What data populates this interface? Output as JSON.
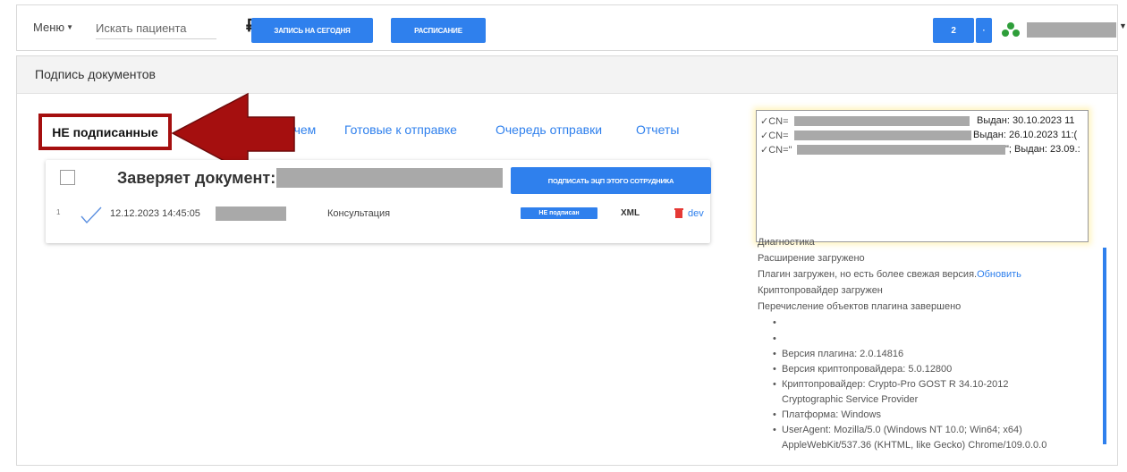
{
  "header": {
    "menu_label": "Меню",
    "search_placeholder": "Искать пациента",
    "currency_symbol": "₽",
    "btn_today": "ЗАПИСЬ НА СЕГОДНЯ",
    "btn_schedule": "РАСПИСАНИЕ",
    "notif_count": "2"
  },
  "panel": {
    "title": "Подпись документов",
    "tabs": [
      {
        "label": "НЕ подписанные",
        "active": true
      },
      {
        "label": "Врачем",
        "active": false
      },
      {
        "label": "Готовые к отправке",
        "active": false
      },
      {
        "label": "Очередь отправки",
        "active": false
      },
      {
        "label": "Отчеты",
        "active": false
      }
    ]
  },
  "document": {
    "title": "Заверяет документ:",
    "sign_button": "ПОДПИСАТЬ ЭЦП ЭТОГО СОТРУДНИКА",
    "rows": [
      {
        "num": "1",
        "date": "12.12.2023 14:45:05",
        "type": "Консультация",
        "status": "НЕ подписан",
        "format": "XML",
        "action": "dev"
      }
    ]
  },
  "certificates": [
    {
      "prefix": "✓CN=",
      "issued": "Выдан: 30.10.2023 11"
    },
    {
      "prefix": "✓CN=",
      "issued": "Выдан: 26.10.2023 11:("
    },
    {
      "prefix": "✓CN=\"",
      "issued": "\"; Выдан: 23.09.:"
    }
  ],
  "diagnostics": {
    "title": "Диагностика",
    "ext_loaded": "Расширение загружено",
    "plugin_text": "Плагин загружен, но есть более свежая версия.",
    "update_link": "Обновить",
    "crypto_loaded": "Криптопровайдер загружен",
    "enum_done": "Перечисление объектов плагина завершено",
    "items": [
      "",
      "",
      "Версия плагина: 2.0.14816",
      "Версия криптопровайдера: 5.0.12800",
      "Криптопровайдер: Crypto-Pro GOST R 34.10-2012",
      "Cryptographic Service Provider",
      "Платформа: Windows",
      "UserAgent: Mozilla/5.0 (Windows NT 10.0; Win64; x64)",
      "AppleWebKit/537.36 (KHTML, like Gecko) Chrome/109.0.0.0"
    ]
  },
  "colors": {
    "accent": "#2f80ed",
    "annotation": "#a50f0f",
    "redaction": "#a9a9a9"
  }
}
